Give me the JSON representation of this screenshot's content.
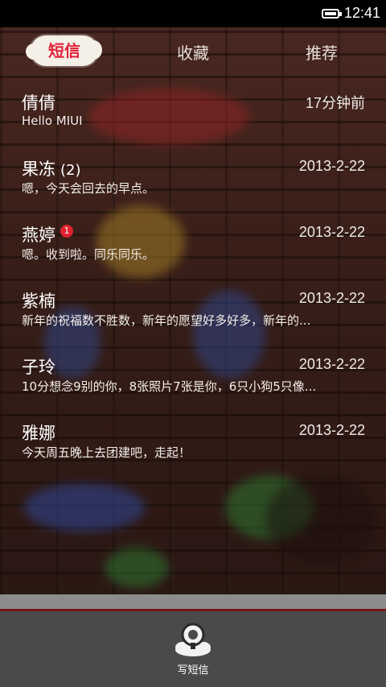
{
  "status_bar": {
    "time": "12:41",
    "battery_icon": "battery-icon"
  },
  "tabs": [
    {
      "label": "短信",
      "active": true
    },
    {
      "label": "收藏",
      "active": false
    },
    {
      "label": "推荐",
      "active": false
    }
  ],
  "conversations": [
    {
      "name": "倩倩",
      "count": "",
      "badge": "",
      "date": "17分钟前",
      "preview": "Hello MIUI"
    },
    {
      "name": "果冻",
      "count": "(2)",
      "badge": "",
      "date": "2013-2-22",
      "preview": "嗯，今天会回去的早点。"
    },
    {
      "name": "燕婷",
      "count": "",
      "badge": "1",
      "date": "2013-2-22",
      "preview": "嗯。收到啦。同乐同乐。"
    },
    {
      "name": "紫楠",
      "count": "",
      "badge": "",
      "date": "2013-2-22",
      "preview": "新年的祝福数不胜数，新年的愿望好多好多，新年的..."
    },
    {
      "name": "子玲",
      "count": "",
      "badge": "",
      "date": "2013-2-22",
      "preview": "10分想念9别的你，8张照片7张是你，6只小狗5只像..."
    },
    {
      "name": "雅娜",
      "count": "",
      "badge": "",
      "date": "2013-2-22",
      "preview": "今天周五晚上去团建吧，走起！"
    }
  ],
  "bottom_bar": {
    "compose_label": "写短信",
    "compose_icon": "compose-message-icon"
  },
  "colors": {
    "active_tab_text": "#e2213a",
    "badge": "#e0212d",
    "bottom_bar": "#4a4a4a"
  }
}
